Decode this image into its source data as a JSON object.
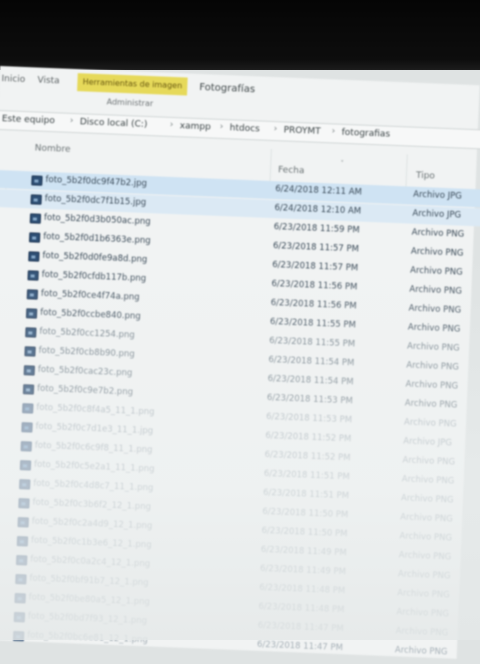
{
  "ribbon": {
    "tabs": [
      "Inicio",
      "Vista"
    ],
    "context_tab": "Herramientas de imagen",
    "title": "Fotografías",
    "sub_tab": "Administrar"
  },
  "address": {
    "crumbs": [
      "Este equipo",
      "Disco local (C:)",
      "xampp",
      "htdocs",
      "PROYMT",
      "fotografias"
    ]
  },
  "columns": {
    "name": "Nombre",
    "date": "Fecha",
    "type": "Tipo"
  },
  "files": [
    {
      "name": "foto_5b2f0dc9f47b2.jpg",
      "date": "6/24/2018 12:11 AM",
      "type": "Archivo JPG"
    },
    {
      "name": "foto_5b2f0dc7f1b15.jpg",
      "date": "6/24/2018 12:10 AM",
      "type": "Archivo JPG"
    },
    {
      "name": "foto_5b2f0d3b050ac.png",
      "date": "6/23/2018 11:59 PM",
      "type": "Archivo PNG"
    },
    {
      "name": "foto_5b2f0d1b6363e.png",
      "date": "6/23/2018 11:57 PM",
      "type": "Archivo PNG"
    },
    {
      "name": "foto_5b2f0d0fe9a8d.png",
      "date": "6/23/2018 11:57 PM",
      "type": "Archivo PNG"
    },
    {
      "name": "foto_5b2f0cfdb117b.png",
      "date": "6/23/2018 11:56 PM",
      "type": "Archivo PNG"
    },
    {
      "name": "foto_5b2f0ce4f74a.png",
      "date": "6/23/2018 11:56 PM",
      "type": "Archivo PNG"
    },
    {
      "name": "foto_5b2f0ccbe840.png",
      "date": "6/23/2018 11:55 PM",
      "type": "Archivo PNG"
    },
    {
      "name": "foto_5b2f0cc1254.png",
      "date": "6/23/2018 11:55 PM",
      "type": "Archivo PNG"
    },
    {
      "name": "foto_5b2f0cb8b90.png",
      "date": "6/23/2018 11:54 PM",
      "type": "Archivo PNG"
    },
    {
      "name": "foto_5b2f0cac23c.png",
      "date": "6/23/2018 11:54 PM",
      "type": "Archivo PNG"
    },
    {
      "name": "foto_5b2f0c9e7b2.png",
      "date": "6/23/2018 11:53 PM",
      "type": "Archivo PNG"
    },
    {
      "name": "foto_5b2f0c8f4a5_11_1.png",
      "date": "6/23/2018 11:53 PM",
      "type": "Archivo PNG"
    },
    {
      "name": "foto_5b2f0c7d1e3_11_1.jpg",
      "date": "6/23/2018 11:52 PM",
      "type": "Archivo JPG"
    },
    {
      "name": "foto_5b2f0c6c9f8_11_1.png",
      "date": "6/23/2018 11:52 PM",
      "type": "Archivo PNG"
    },
    {
      "name": "foto_5b2f0c5e2a1_11_1.png",
      "date": "6/23/2018 11:51 PM",
      "type": "Archivo PNG"
    },
    {
      "name": "foto_5b2f0c4d8c7_11_1.png",
      "date": "6/23/2018 11:51 PM",
      "type": "Archivo PNG"
    },
    {
      "name": "foto_5b2f0c3b6f2_12_1.png",
      "date": "6/23/2018 11:50 PM",
      "type": "Archivo PNG"
    },
    {
      "name": "foto_5b2f0c2a4d9_12_1.png",
      "date": "6/23/2018 11:50 PM",
      "type": "Archivo PNG"
    },
    {
      "name": "foto_5b2f0c1b3e6_12_1.png",
      "date": "6/23/2018 11:49 PM",
      "type": "Archivo PNG"
    },
    {
      "name": "foto_5b2f0c0a2c4_12_1.png",
      "date": "6/23/2018 11:49 PM",
      "type": "Archivo PNG"
    },
    {
      "name": "foto_5b2f0bf91b7_12_1.png",
      "date": "6/23/2018 11:48 PM",
      "type": "Archivo PNG"
    },
    {
      "name": "foto_5b2f0be80a5_12_1.png",
      "date": "6/23/2018 11:48 PM",
      "type": "Archivo PNG"
    },
    {
      "name": "foto_5b2f0bd7f93_12_1.png",
      "date": "6/23/2018 11:47 PM",
      "type": "Archivo PNG"
    },
    {
      "name": "foto_5b2f0bc6e81_12_1.png",
      "date": "6/23/2018 11:47 PM",
      "type": "Archivo PNG"
    }
  ]
}
